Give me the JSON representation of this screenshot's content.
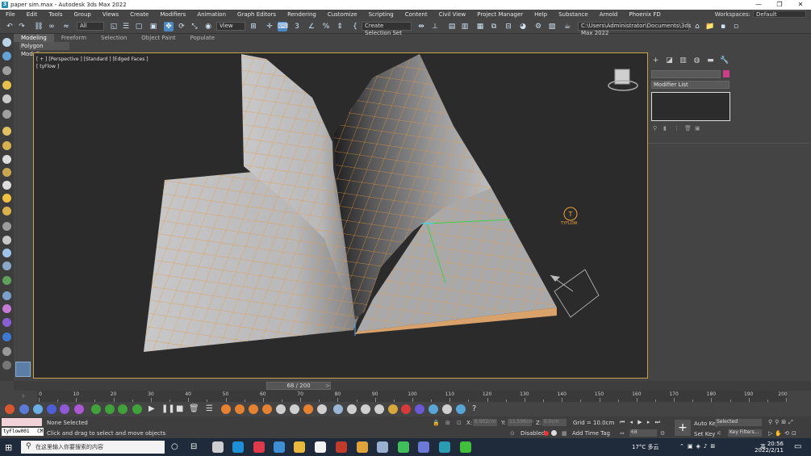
{
  "window": {
    "title": "paper sim.max - Autodesk 3ds Max 2022",
    "minimize": "—",
    "restore": "❐",
    "close": "✕"
  },
  "menu": [
    "File",
    "Edit",
    "Tools",
    "Group",
    "Views",
    "Create",
    "Modifiers",
    "Animation",
    "Graph Editors",
    "Rendering",
    "Customize",
    "Scripting",
    "Content",
    "Civil View",
    "Project Manager",
    "Help",
    "Substance",
    "Arnold",
    "Phoenix FD"
  ],
  "workspaces": {
    "label": "Workspaces:",
    "value": "Default"
  },
  "toolbar": {
    "selection_filter": "All",
    "ref_coord": "View",
    "named_selection": "Create Selection Set",
    "project_path": "C:\\Users\\Administrator\\Documents\\3ds Max 2022"
  },
  "ribbon": {
    "tabs": [
      "Modeling",
      "Freeform",
      "Selection",
      "Object Paint",
      "Populate"
    ],
    "active": "Modeling",
    "panel_label": "Polygon Modeling"
  },
  "viewport": {
    "label": "[ + ] [Perspective ] [Standard ] [Edged Faces ]",
    "object_label": "[ tyFlow ]",
    "tyflow_logo_text": "TYFLOW",
    "accent": "#f0a33a"
  },
  "command_panel": {
    "modifier_list": "Modifier List",
    "swatch_color": "#cc3d8a"
  },
  "timeline": {
    "frame_display": "68 / 200",
    "ticks": [
      0,
      10,
      20,
      30,
      40,
      50,
      60,
      70,
      80,
      90,
      100,
      110,
      120,
      130,
      140,
      150,
      160,
      170,
      180,
      190,
      200
    ]
  },
  "status": {
    "maxscript": "tyFlow001",
    "maxscript_tag": "CM",
    "selection": "None Selected",
    "prompt": "Click and drag to select and move objects",
    "x": "X:",
    "x_val": "6.902cm",
    "y": "Y:",
    "y_val": "11.596cm",
    "z": "Z:",
    "z_val": "0.0cm",
    "grid": "Grid = 10.0cm",
    "disabled": "Disabled:",
    "add_time_tag": "Add Time Tag",
    "auto_key": "Auto Key",
    "selected": "Selected",
    "set_key": "Set Key",
    "key_filters": "Key Filters...",
    "frame": "68"
  },
  "taskbar": {
    "search_placeholder": "在这里输入你要搜索的内容",
    "weather": "17°C 多云",
    "ime": "英",
    "time": "20:56",
    "date": "2022/2/11"
  }
}
